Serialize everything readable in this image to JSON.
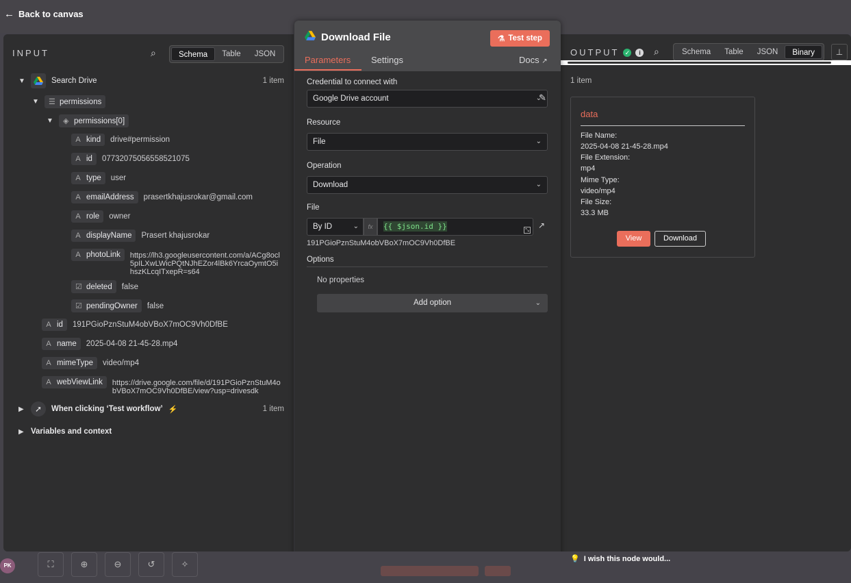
{
  "top": {
    "back_label": "Back to canvas"
  },
  "input": {
    "title": "INPUT",
    "views": [
      "Schema",
      "Table",
      "JSON"
    ],
    "active_view": "Schema",
    "source_node": "Search Drive",
    "source_count": "1 item",
    "fields": {
      "permissions": "permissions",
      "permissions0": "permissions[0]",
      "kind": {
        "key": "kind",
        "value": "drive#permission"
      },
      "id": {
        "key": "id",
        "value": "07732075056558521075"
      },
      "type": {
        "key": "type",
        "value": "user"
      },
      "email": {
        "key": "emailAddress",
        "value": "prasertkhajusrokar@gmail.com"
      },
      "role": {
        "key": "role",
        "value": "owner"
      },
      "displayName": {
        "key": "displayName",
        "value": "Prasert khajusrokar"
      },
      "photoLink": {
        "key": "photoLink",
        "value": "https://lh3.googleusercontent.com/a/ACg8ocl5pILXwLWicPQtNJhEZor4lBk6YrcaOymtO5ihszKLcqITxepR=s64"
      },
      "deleted": {
        "key": "deleted",
        "value": "false"
      },
      "pendingOwner": {
        "key": "pendingOwner",
        "value": "false"
      },
      "fileId": {
        "key": "id",
        "value": "191PGioPznStuM4obVBoX7mOC9Vh0DfBE"
      },
      "name": {
        "key": "name",
        "value": "2025-04-08 21-45-28.mp4"
      },
      "mimeType": {
        "key": "mimeType",
        "value": "video/mp4"
      },
      "webViewLink": {
        "key": "webViewLink",
        "value": "https://drive.google.com/file/d/191PGioPznStuM4obVBoX7mOC9Vh0DfBE/view?usp=drivesdk"
      }
    },
    "trigger_node": "When clicking ‘Test workflow’",
    "trigger_count": "1 item",
    "variables_label": "Variables and context"
  },
  "node": {
    "title": "Download File",
    "test_button": "Test step",
    "tabs": {
      "parameters": "Parameters",
      "settings": "Settings",
      "docs": "Docs"
    },
    "credential_label": "Credential to connect with",
    "credential_value": "Google Drive account",
    "resource_label": "Resource",
    "resource_value": "File",
    "operation_label": "Operation",
    "operation_value": "Download",
    "file_label": "File",
    "file_mode": "By ID",
    "fx": "fx",
    "file_expression": "{{ $json.id }}",
    "file_resolved": "191PGioPznStuM4obVBoX7mOC9Vh0DfBE",
    "options_label": "Options",
    "no_properties": "No properties",
    "add_option": "Add option"
  },
  "output": {
    "title": "OUTPUT",
    "views": [
      "Schema",
      "Table",
      "JSON",
      "Binary"
    ],
    "active_view": "Binary",
    "count": "1 item",
    "card": {
      "title": "data",
      "file_name_label": "File Name:",
      "file_name": "2025-04-08 21-45-28.mp4",
      "file_ext_label": "File Extension:",
      "file_ext": "mp4",
      "mime_label": "Mime Type:",
      "mime": "video/mp4",
      "size_label": "File Size:",
      "size": "33.3 MB",
      "view_button": "View",
      "download_button": "Download"
    }
  },
  "footer": {
    "wish": "I wish this node would...",
    "avatar": "PK"
  },
  "colors": {
    "accent": "#ea6e5b",
    "success": "#2bb36f",
    "expression": "#7ee08a"
  }
}
